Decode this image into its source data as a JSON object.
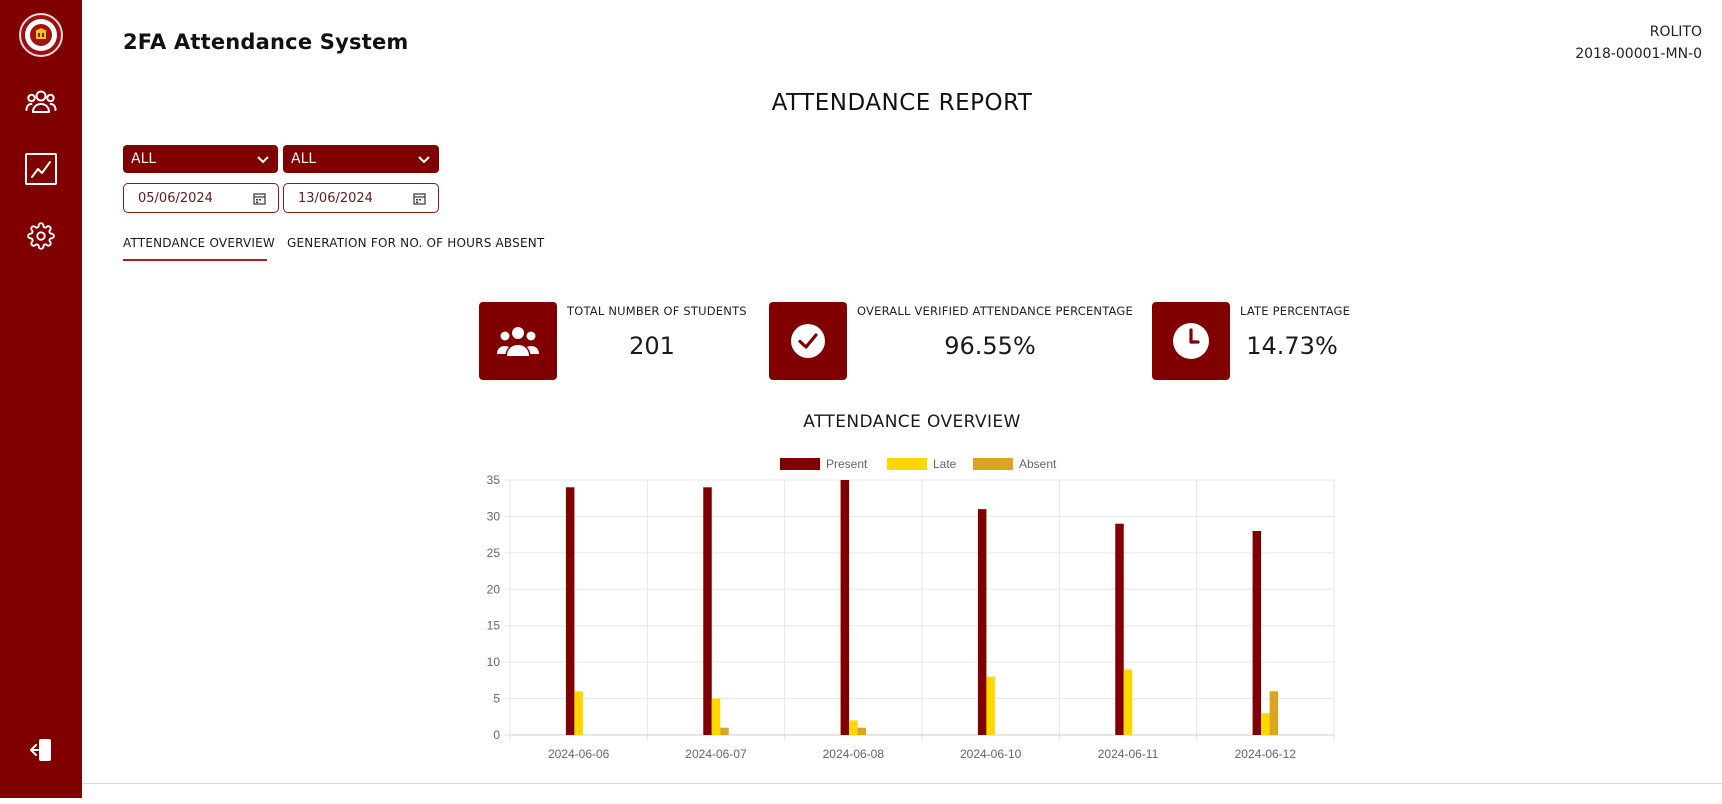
{
  "app": {
    "title": "2FA Attendance System"
  },
  "user": {
    "name": "ROLITO",
    "id": "2018-00001-MN-0"
  },
  "sidebar": {
    "items": [
      {
        "icon": "users-icon"
      },
      {
        "icon": "chart-line-icon"
      },
      {
        "icon": "gear-icon"
      }
    ],
    "logout_icon": "logout-icon"
  },
  "report": {
    "title": "ATTENDANCE REPORT"
  },
  "filters": {
    "select1": "ALL",
    "select2": "ALL",
    "date_from": "05/06/2024",
    "date_to": "13/06/2024"
  },
  "tabs": [
    {
      "label": "ATTENDANCE OVERVIEW",
      "active": true
    },
    {
      "label": "GENERATION FOR NO. OF HOURS ABSENT",
      "active": false
    }
  ],
  "stats": [
    {
      "label": "TOTAL NUMBER OF STUDENTS",
      "value": "201",
      "icon": "users-group-icon"
    },
    {
      "label": "OVERALL VERIFIED ATTENDANCE PERCENTAGE",
      "value": "96.55%",
      "icon": "check-circle-icon"
    },
    {
      "label": "LATE PERCENTAGE",
      "value": "14.73%",
      "icon": "clock-icon"
    }
  ],
  "colors": {
    "brand": "#800000",
    "present": "#800000",
    "late": "#FFD700",
    "absent": "#DAA520"
  },
  "chart_title": "ATTENDANCE OVERVIEW",
  "chart_data": {
    "type": "bar",
    "title": "ATTENDANCE OVERVIEW",
    "categories": [
      "2024-06-06",
      "2024-06-07",
      "2024-06-08",
      "2024-06-10",
      "2024-06-11",
      "2024-06-12"
    ],
    "series": [
      {
        "name": "Present",
        "values": [
          34,
          34,
          35,
          31,
          29,
          28
        ]
      },
      {
        "name": "Late",
        "values": [
          6,
          5,
          2,
          8,
          9,
          3
        ]
      },
      {
        "name": "Absent",
        "values": [
          0,
          1,
          1,
          0,
          0,
          6
        ]
      }
    ],
    "ylim": [
      0,
      35
    ],
    "yticks": [
      0,
      5,
      10,
      15,
      20,
      25,
      30,
      35
    ],
    "grid": true,
    "legend": "top"
  }
}
